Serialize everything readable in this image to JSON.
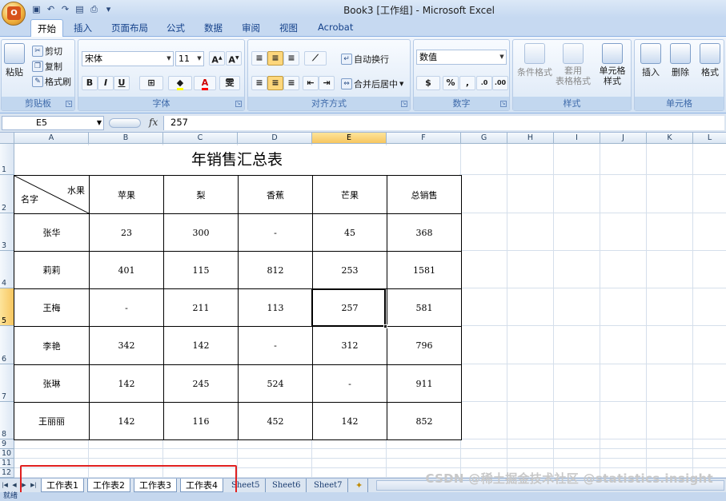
{
  "window": {
    "title": "Book3  [工作组] - Microsoft Excel"
  },
  "office_button": {
    "label": "O"
  },
  "ribbon_tabs": [
    "开始",
    "插入",
    "页面布局",
    "公式",
    "数据",
    "审阅",
    "视图",
    "Acrobat"
  ],
  "ribbon": {
    "clipboard": {
      "paste": "粘贴",
      "cut": "剪切",
      "copy": "复制",
      "format_painter": "格式刷",
      "label": "剪贴板"
    },
    "font": {
      "name": "宋体",
      "size": "11",
      "bold": "B",
      "italic": "I",
      "underline": "U",
      "wen": "雯",
      "label": "字体"
    },
    "alignment": {
      "wrap_text": "自动换行",
      "merge_center": "合并后居中",
      "label": "对齐方式"
    },
    "number": {
      "format": "数值",
      "percent": "%",
      "comma": ",",
      "label": "数字"
    },
    "styles": {
      "conditional_format": "条件格式",
      "table_format_line1": "套用",
      "table_format_line2": "表格格式",
      "cell_styles_line1": "单元格",
      "cell_styles_line2": "样式",
      "label": "样式"
    },
    "cells": {
      "insert": "插入",
      "delete": "删除",
      "format": "格式",
      "label": "单元格"
    }
  },
  "formula_bar": {
    "name_box": "E5",
    "fx": "fx",
    "value": "257"
  },
  "columns": [
    "A",
    "B",
    "C",
    "D",
    "E",
    "F",
    "G",
    "H",
    "I",
    "J",
    "K",
    "L"
  ],
  "rows": [
    "1",
    "2",
    "3",
    "4",
    "5",
    "6",
    "7",
    "8",
    "9",
    "10",
    "11",
    "12"
  ],
  "sheet": {
    "title": "年销售汇总表",
    "header_fruit": "水果",
    "header_name": "名字",
    "headers": [
      "苹果",
      "梨",
      "香蕉",
      "芒果",
      "总销售"
    ],
    "data": [
      {
        "name": "张华",
        "values": [
          "23",
          "300",
          "-",
          "45",
          "368"
        ]
      },
      {
        "name": "莉莉",
        "values": [
          "401",
          "115",
          "812",
          "253",
          "1581"
        ]
      },
      {
        "name": "王梅",
        "values": [
          "-",
          "211",
          "113",
          "257",
          "581"
        ]
      },
      {
        "name": "李艳",
        "values": [
          "342",
          "142",
          "-",
          "312",
          "796"
        ]
      },
      {
        "name": "张琳",
        "values": [
          "142",
          "245",
          "524",
          "-",
          "911"
        ]
      },
      {
        "name": "王丽丽",
        "values": [
          "142",
          "116",
          "452",
          "142",
          "852"
        ]
      }
    ]
  },
  "sheet_tabs": [
    "工作表1",
    "工作表2",
    "工作表3",
    "工作表4",
    "Sheet5",
    "Sheet6",
    "Sheet7"
  ],
  "status": {
    "text": "就绪"
  },
  "watermark": "CSDN @稀土掘金技术社区 @statistics.insight"
}
